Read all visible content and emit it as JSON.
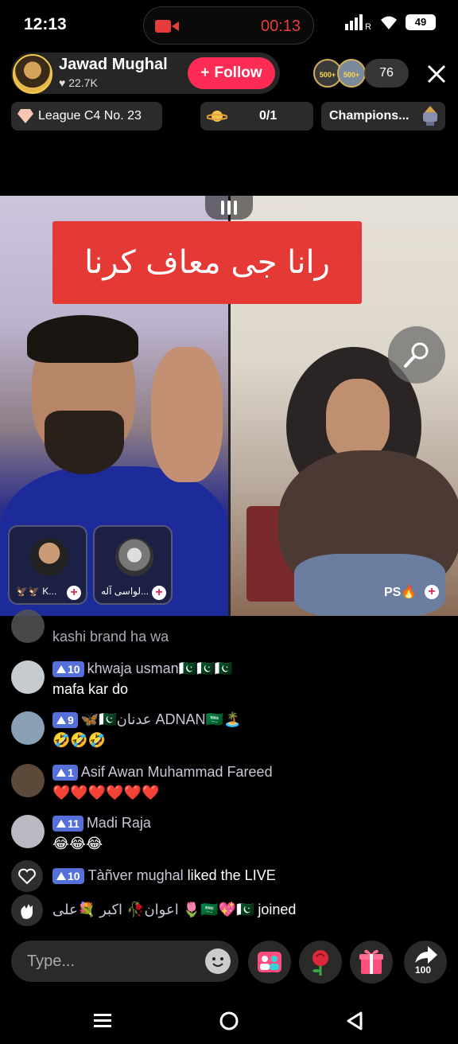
{
  "status_bar": {
    "time": "12:13",
    "recording_time": "00:13",
    "network_label": "R",
    "battery": "49"
  },
  "host": {
    "name": "Jawad Mughal",
    "likes": "22.7K",
    "follow_label": "Follow",
    "viewer_badges": [
      "500+",
      "500+"
    ],
    "viewer_count": "76"
  },
  "info": {
    "league": "League C4 No. 23",
    "goal": "0/1",
    "champions": "Champions..."
  },
  "stream": {
    "banner_text": "رانا جی معاف کرنا",
    "guests": [
      {
        "name": "🦅🦅 K..."
      },
      {
        "name": "لواسی آله..."
      }
    ],
    "right_label": "PS🔥"
  },
  "chat": {
    "messages": [
      {
        "name": "kashi brand ha wa",
        "level": "",
        "text": ""
      },
      {
        "name": "khwaja usman🇵🇰🇵🇰🇵🇰",
        "level": "10",
        "text": "mafa kar do"
      },
      {
        "name": "🦋🇵🇰عدنان ADNAN🇸🇦🏝️",
        "level": "9",
        "text": "🤣🤣🤣"
      },
      {
        "name": "Asif Awan Muhammad Fareed",
        "level": "1",
        "text": "❤️❤️❤️❤️❤️❤️"
      },
      {
        "name": "Madi Raja",
        "level": "11",
        "text": "😂😂😂"
      }
    ],
    "like_event": {
      "level": "10",
      "name": "Tàñver mughal",
      "action": "liked the LIVE"
    },
    "join_event": {
      "name": "اعوان🥀 اکبر 💐علی 🌷🇸🇦💖🇵🇰",
      "action": "joined"
    }
  },
  "bottom": {
    "placeholder": "Type...",
    "share_count": "100"
  },
  "colors": {
    "accent": "#fe2c55",
    "banner": "#e53935",
    "badge": "#5570d8",
    "recording": "#e83b3b"
  },
  "icons": [
    "camera-icon",
    "signal-icon",
    "wifi-icon",
    "battery-icon",
    "heart-icon",
    "plus-icon",
    "close-icon",
    "diamond-icon",
    "planet-icon",
    "trophy-icon",
    "pause-icon",
    "microphone-icon",
    "emoji-icon",
    "multi-guest-icon",
    "rose-icon",
    "gift-icon",
    "share-icon",
    "menu-icon",
    "home-icon",
    "back-icon"
  ]
}
